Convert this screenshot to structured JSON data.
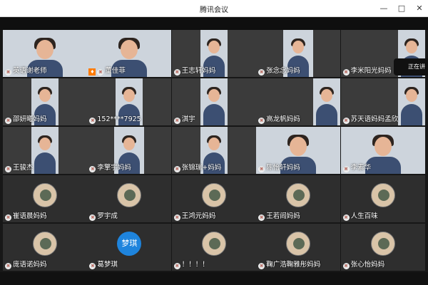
{
  "window": {
    "title": "腾讯会议",
    "minimize": "—",
    "maximize": "□",
    "close": "✕"
  },
  "speaking_hint": "正在讲",
  "participants": [
    {
      "name": "英语谢老师",
      "type": "video"
    },
    {
      "name": "董佳菲",
      "type": "video",
      "host": true
    },
    {
      "name": "王志轩妈妈",
      "type": "video"
    },
    {
      "name": "张念念妈妈",
      "type": "video"
    },
    {
      "name": "李米阳光妈妈",
      "type": "video"
    },
    {
      "name": "邵妍曦妈妈",
      "type": "video"
    },
    {
      "name": "152****7925",
      "type": "video"
    },
    {
      "name": "淇宇",
      "type": "video"
    },
    {
      "name": "高龙帆妈妈",
      "type": "video"
    },
    {
      "name": "苏天语妈妈孟欣",
      "type": "video"
    },
    {
      "name": "王骏杰",
      "type": "video"
    },
    {
      "name": "李擎宇妈妈",
      "type": "video"
    },
    {
      "name": "张锦瑞+妈妈",
      "type": "video"
    },
    {
      "name": "陈怡轩妈妈",
      "type": "video"
    },
    {
      "name": "李素华",
      "type": "video"
    },
    {
      "name": "崔语晨妈妈",
      "type": "avatar"
    },
    {
      "name": "罗宇成",
      "type": "avatar"
    },
    {
      "name": "王鸿元妈妈",
      "type": "avatar"
    },
    {
      "name": "王若阎妈妈",
      "type": "avatar"
    },
    {
      "name": "人生百味",
      "type": "avatar"
    },
    {
      "name": "庞语诺妈妈",
      "type": "avatar"
    },
    {
      "name": "葛梦琪",
      "type": "avatar",
      "avatar_text": "梦琪"
    },
    {
      "name": "！！！！",
      "type": "avatar"
    },
    {
      "name": "鞠广浩鞠雅彤妈妈",
      "type": "avatar"
    },
    {
      "name": "张心怡妈妈",
      "type": "avatar"
    }
  ],
  "colors": {
    "active_border": "#37b34a",
    "host_badge": "#ff7b00",
    "avatar_blue": "#1e84dd"
  }
}
